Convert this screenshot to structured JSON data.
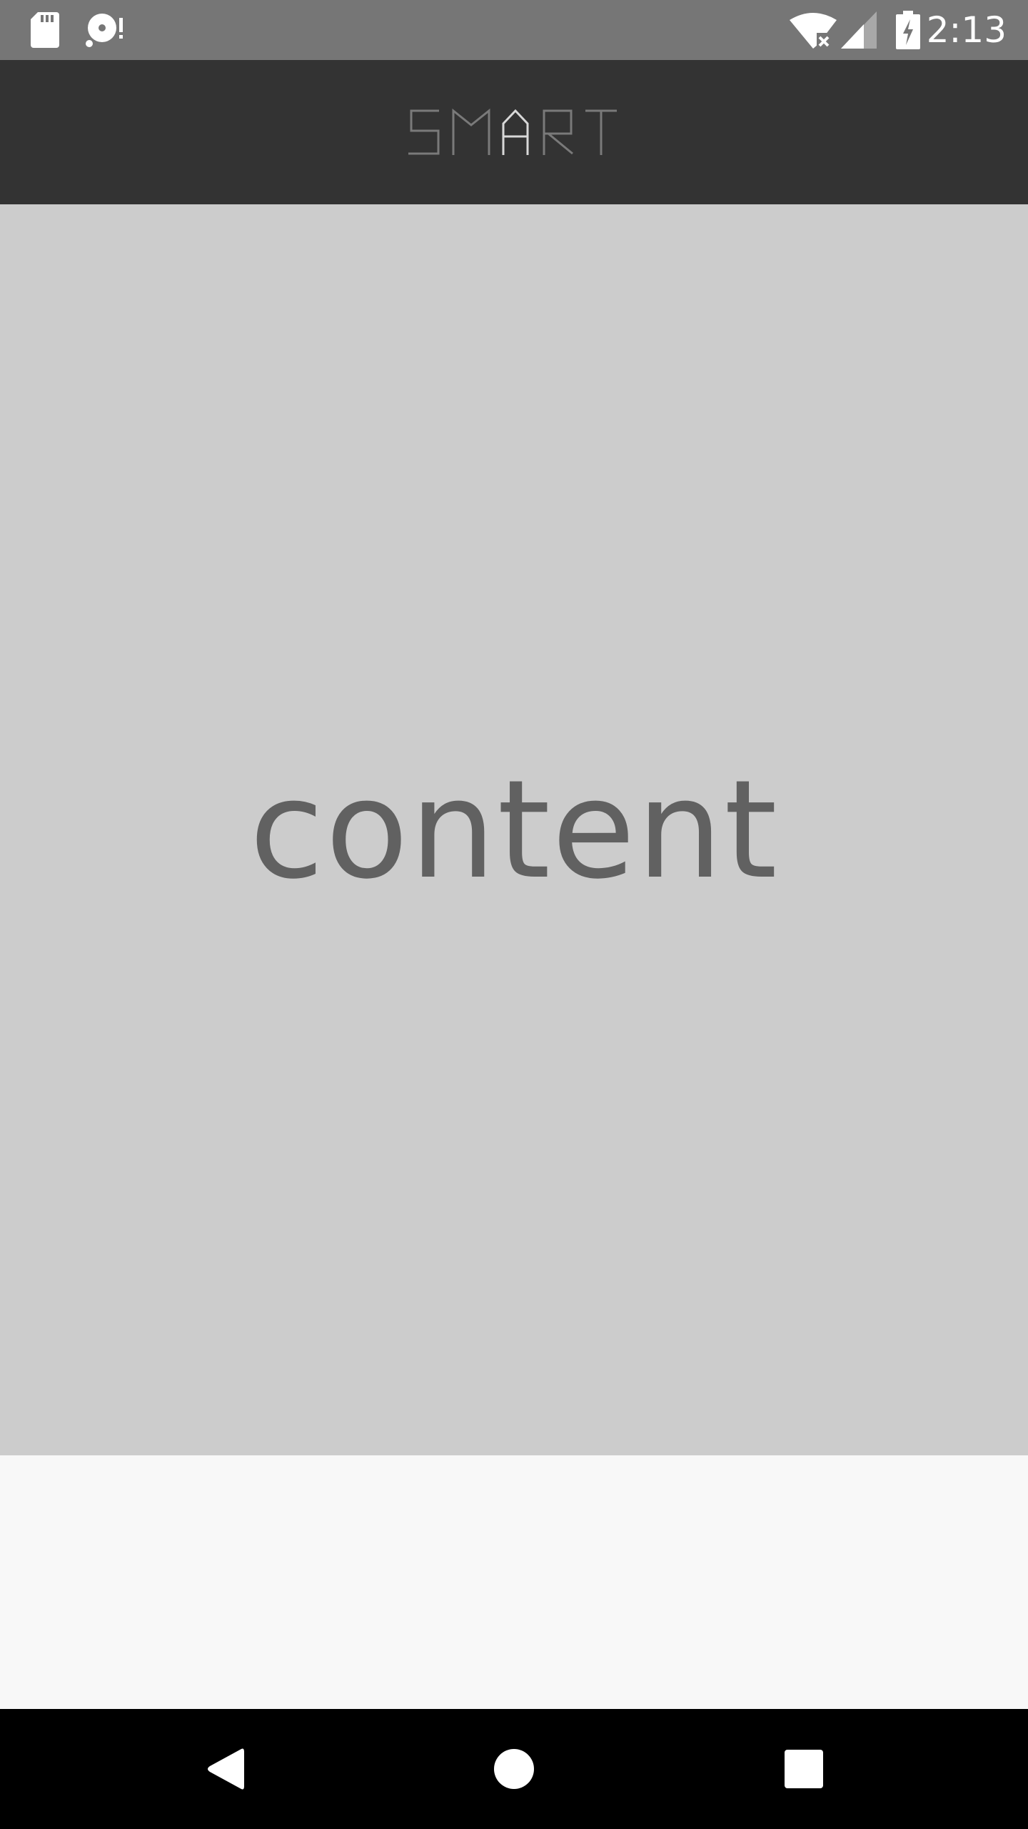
{
  "status_bar": {
    "time": "2:13",
    "icons": {
      "left": [
        "sd-card-icon",
        "disc-alert-icon"
      ],
      "right": [
        "wifi-off-icon",
        "cell-signal-icon",
        "battery-charging-icon"
      ]
    }
  },
  "app_bar": {
    "logo_text": "SMART"
  },
  "main": {
    "content_text": "content"
  },
  "nav_bar": {
    "buttons": [
      "back-icon",
      "home-icon",
      "recents-icon"
    ]
  },
  "colors": {
    "status_bar": "#767676",
    "app_bar": "#333333",
    "content_bg": "#cccccc",
    "content_text": "#616161",
    "bottom_bg": "#f8f8f8",
    "nav_bar": "#000000"
  }
}
